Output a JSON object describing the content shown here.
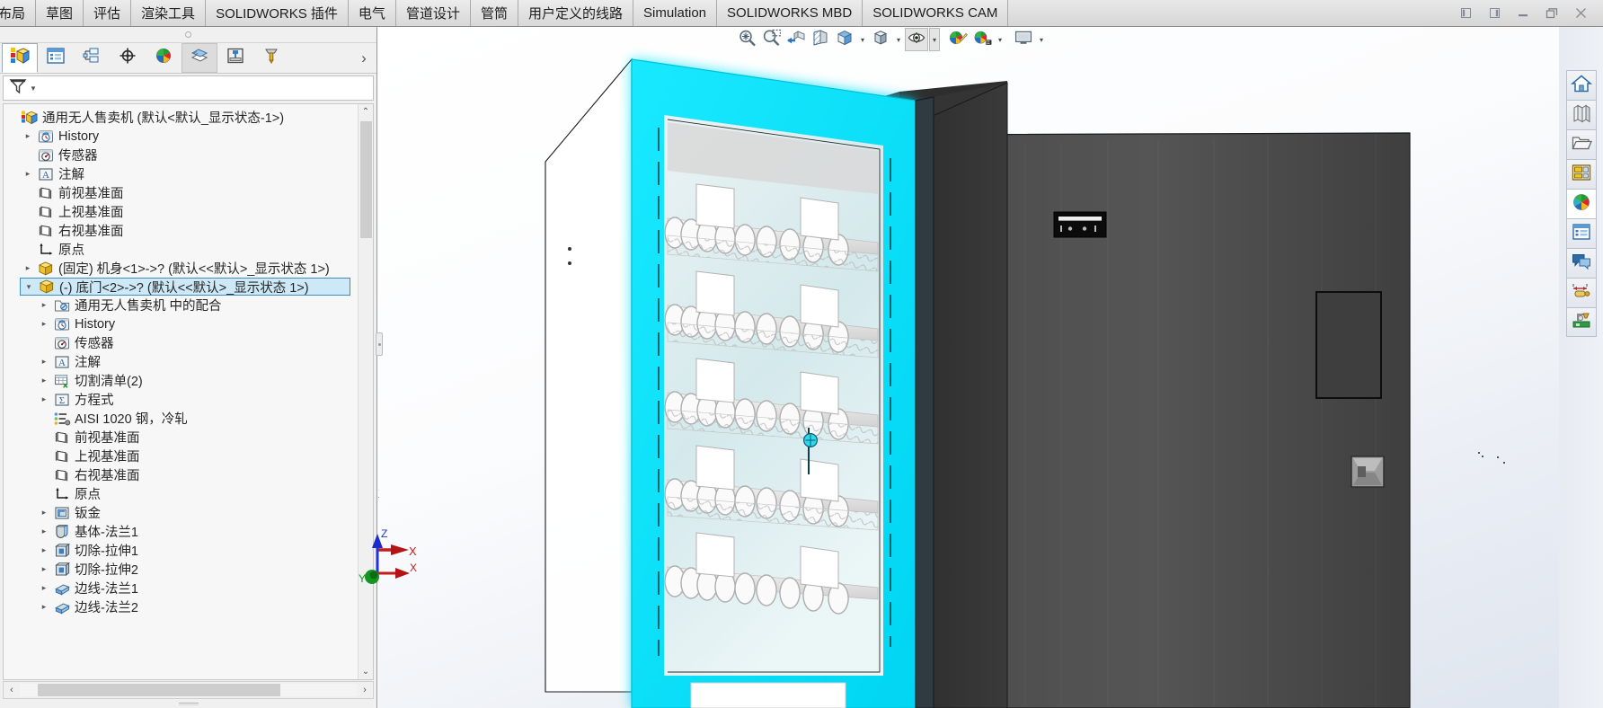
{
  "app": {
    "title": "SOLIDWORKS",
    "accent": "#cde8f7",
    "selection_color": "#00e5ff"
  },
  "command_tabs": [
    {
      "label": "布局",
      "active": false
    },
    {
      "label": "草图",
      "active": false
    },
    {
      "label": "评估",
      "active": false
    },
    {
      "label": "渲染工具",
      "active": false
    },
    {
      "label": "SOLIDWORKS 插件",
      "active": false
    },
    {
      "label": "电气",
      "active": false
    },
    {
      "label": "管道设计",
      "active": false
    },
    {
      "label": "管筒",
      "active": false
    },
    {
      "label": "用户定义的线路",
      "active": false
    },
    {
      "label": "Simulation",
      "active": false
    },
    {
      "label": "SOLIDWORKS MBD",
      "active": false
    },
    {
      "label": "SOLIDWORKS CAM",
      "active": false
    }
  ],
  "window_controls": [
    {
      "name": "restore-left",
      "glyph": "◧"
    },
    {
      "name": "restore-right",
      "glyph": "◨"
    },
    {
      "name": "minimize",
      "glyph": "—"
    },
    {
      "name": "maximize",
      "glyph": "❐"
    },
    {
      "name": "close",
      "glyph": "✕"
    }
  ],
  "feature_manager": {
    "tabs": [
      {
        "name": "feature-tree-tab",
        "icon": "assembly-tree-icon",
        "state": "selected"
      },
      {
        "name": "property-manager-tab",
        "icon": "property-list-icon",
        "state": "normal"
      },
      {
        "name": "configuration-manager-tab",
        "icon": "configuration-icon",
        "state": "normal"
      },
      {
        "name": "dimxpert-manager-tab",
        "icon": "dimxpert-icon",
        "state": "normal"
      },
      {
        "name": "display-manager-tab",
        "icon": "appearance-ball-icon",
        "state": "normal"
      },
      {
        "name": "motion-study-tab",
        "icon": "layers-icon",
        "state": "shaded"
      },
      {
        "name": "simulation-tab",
        "icon": "simulation-icon",
        "state": "normal"
      },
      {
        "name": "cam-tab",
        "icon": "cam-tool-icon",
        "state": "normal"
      }
    ],
    "expand_chevron": "›",
    "filter": {
      "icon": "filter-funnel-icon",
      "placeholder": "",
      "value": ""
    },
    "tree": [
      {
        "indent": 0,
        "expander": "none",
        "icon": "assembly-icon",
        "label": "通用无人售卖机  (默认<默认_显示状态-1>)",
        "selected": false
      },
      {
        "indent": 1,
        "expander": "collapsed",
        "icon": "history-icon",
        "label": "History",
        "selected": false
      },
      {
        "indent": 1,
        "expander": "none",
        "icon": "sensor-icon",
        "label": "传感器",
        "selected": false
      },
      {
        "indent": 1,
        "expander": "collapsed",
        "icon": "annotation-icon",
        "label": "注解",
        "selected": false
      },
      {
        "indent": 1,
        "expander": "none",
        "icon": "plane-icon",
        "label": "前视基准面",
        "selected": false
      },
      {
        "indent": 1,
        "expander": "none",
        "icon": "plane-icon",
        "label": "上视基准面",
        "selected": false
      },
      {
        "indent": 1,
        "expander": "none",
        "icon": "plane-icon",
        "label": "右视基准面",
        "selected": false
      },
      {
        "indent": 1,
        "expander": "none",
        "icon": "origin-icon",
        "label": "原点",
        "selected": false
      },
      {
        "indent": 1,
        "expander": "collapsed",
        "icon": "part-icon",
        "label": "(固定) 机身<1>->? (默认<<默认>_显示状态 1>)",
        "selected": false
      },
      {
        "indent": 1,
        "expander": "expanded",
        "icon": "part-icon",
        "label": "(-) 底门<2>->? (默认<<默认>_显示状态 1>)",
        "selected": true
      },
      {
        "indent": 2,
        "expander": "collapsed",
        "icon": "mates-icon",
        "label": "通用无人售卖机 中的配合",
        "selected": false
      },
      {
        "indent": 2,
        "expander": "collapsed",
        "icon": "history-icon",
        "label": "History",
        "selected": false
      },
      {
        "indent": 2,
        "expander": "none",
        "icon": "sensor-icon",
        "label": "传感器",
        "selected": false
      },
      {
        "indent": 2,
        "expander": "collapsed",
        "icon": "annotation-icon",
        "label": "注解",
        "selected": false
      },
      {
        "indent": 2,
        "expander": "collapsed",
        "icon": "cutlist-icon",
        "label": "切割清单(2)",
        "selected": false
      },
      {
        "indent": 2,
        "expander": "collapsed",
        "icon": "equations-icon",
        "label": "方程式",
        "selected": false
      },
      {
        "indent": 2,
        "expander": "none",
        "icon": "material-icon",
        "label": "AISI 1020 钢，冷轧",
        "selected": false
      },
      {
        "indent": 2,
        "expander": "none",
        "icon": "plane-icon",
        "label": "前视基准面",
        "selected": false
      },
      {
        "indent": 2,
        "expander": "none",
        "icon": "plane-icon",
        "label": "上视基准面",
        "selected": false
      },
      {
        "indent": 2,
        "expander": "none",
        "icon": "plane-icon",
        "label": "右视基准面",
        "selected": false
      },
      {
        "indent": 2,
        "expander": "none",
        "icon": "origin-icon",
        "label": "原点",
        "selected": false
      },
      {
        "indent": 2,
        "expander": "collapsed",
        "icon": "sheetmetal-icon",
        "label": "钣金",
        "selected": false
      },
      {
        "indent": 2,
        "expander": "collapsed",
        "icon": "base-flange-icon",
        "label": "基体-法兰1",
        "selected": false
      },
      {
        "indent": 2,
        "expander": "collapsed",
        "icon": "extrude-cut-icon",
        "label": "切除-拉伸1",
        "selected": false
      },
      {
        "indent": 2,
        "expander": "collapsed",
        "icon": "extrude-cut-icon",
        "label": "切除-拉伸2",
        "selected": false
      },
      {
        "indent": 2,
        "expander": "collapsed",
        "icon": "edge-flange-icon",
        "label": "边线-法兰1",
        "selected": false
      },
      {
        "indent": 2,
        "expander": "collapsed",
        "icon": "edge-flange-icon",
        "label": "边线-法兰2",
        "selected": false
      }
    ],
    "scrollbar": {
      "up_arrow": "⌃",
      "down_arrow": "⌄",
      "left_arrow": "‹",
      "right_arrow": "›"
    }
  },
  "view_toolbar": [
    {
      "name": "zoom-to-fit-button",
      "icon": "magnifier-fit-icon",
      "framed": false,
      "caret": false
    },
    {
      "name": "zoom-to-area-button",
      "icon": "magnifier-area-icon",
      "framed": false,
      "caret": false
    },
    {
      "name": "previous-view-button",
      "icon": "previous-view-icon",
      "framed": false,
      "caret": false
    },
    {
      "name": "section-view-button",
      "icon": "section-view-icon",
      "framed": false,
      "caret": false
    },
    {
      "name": "view-orientation-button",
      "icon": "view-orientation-icon",
      "framed": false,
      "caret": true
    },
    {
      "name": "display-style-button",
      "icon": "display-style-icon",
      "framed": false,
      "caret": true
    },
    {
      "name": "hide-show-items-button",
      "icon": "eye-icon",
      "framed": true,
      "caret": true
    },
    {
      "name": "edit-appearance-button",
      "icon": "appearance-pencil-icon",
      "framed": false,
      "caret": false
    },
    {
      "name": "apply-scene-button",
      "icon": "scene-icon",
      "framed": false,
      "caret": true
    },
    {
      "name": "viewport-button",
      "icon": "viewport-icon",
      "framed": false,
      "caret": true
    }
  ],
  "task_pane": [
    {
      "name": "solidworks-resources-button",
      "icon": "home-icon",
      "active": false
    },
    {
      "name": "design-library-button",
      "icon": "design-library-icon",
      "active": false
    },
    {
      "name": "file-explorer-button",
      "icon": "folder-icon",
      "active": false
    },
    {
      "name": "view-palette-button",
      "icon": "view-palette-icon",
      "active": false
    },
    {
      "name": "appearances-scenes-button",
      "icon": "appearance-ball-icon",
      "active": true
    },
    {
      "name": "custom-properties-button",
      "icon": "property-list-icon",
      "active": false
    },
    {
      "name": "solidworks-forum-button",
      "icon": "chat-bubbles-icon",
      "active": false
    },
    {
      "name": "mbd-dimension-button",
      "icon": "dimension-icon",
      "active": false
    },
    {
      "name": "cam-feature-button",
      "icon": "cam-machine-icon",
      "active": false
    }
  ],
  "viewport": {
    "triad": {
      "z_label": "Z",
      "x_label": "X",
      "y_label": "Y",
      "z_color": "#0b1fc4",
      "x_color": "#c40b0b",
      "y_color": "#0f9a18"
    },
    "model": {
      "name": "通用无人售卖机",
      "selected_component": "底门",
      "highlight_color": "#00e5ff",
      "cabinet_color": "#4c4c4c",
      "shelf_color": "#e8e8e8",
      "shelf_rows": 5,
      "products_per_row": 9
    }
  }
}
